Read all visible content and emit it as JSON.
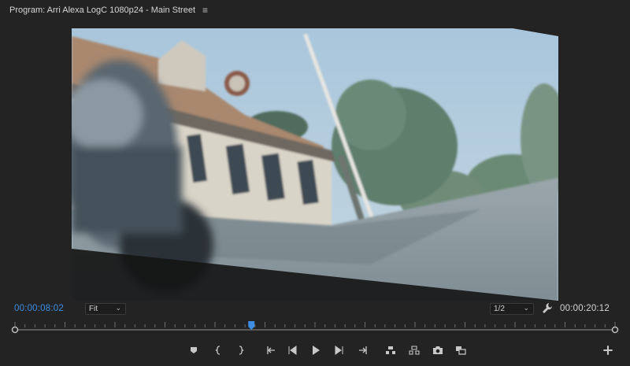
{
  "panel": {
    "title": "Program: Arri Alexa LogC 1080p24 - Main Street",
    "menu_icon": "hamburger-menu-icon"
  },
  "timecode": {
    "current": "00:00:08:02",
    "duration": "00:00:20:12"
  },
  "zoom_select": {
    "value": "Fit"
  },
  "resolution_select": {
    "value": "1/2"
  },
  "playhead": {
    "position_fraction": 0.394
  },
  "colors": {
    "accent": "#3d8de3",
    "panel_bg": "#232323",
    "control_icon": "#c8c8c8"
  },
  "controls": [
    {
      "name": "add-marker-button",
      "icon": "marker-icon"
    },
    {
      "name": "mark-in-button",
      "icon": "mark-in-icon"
    },
    {
      "name": "mark-out-button",
      "icon": "mark-out-icon"
    },
    {
      "name": "go-to-in-button",
      "icon": "go-to-in-icon"
    },
    {
      "name": "step-back-button",
      "icon": "step-back-icon"
    },
    {
      "name": "play-button",
      "icon": "play-icon"
    },
    {
      "name": "step-forward-button",
      "icon": "step-forward-icon"
    },
    {
      "name": "go-to-out-button",
      "icon": "go-to-out-icon"
    },
    {
      "name": "lift-button",
      "icon": "lift-icon"
    },
    {
      "name": "extract-button",
      "icon": "extract-icon"
    },
    {
      "name": "export-frame-button",
      "icon": "camera-icon"
    },
    {
      "name": "comparison-view-button",
      "icon": "comparison-view-icon"
    },
    {
      "name": "button-editor-button",
      "icon": "plus-icon"
    }
  ]
}
